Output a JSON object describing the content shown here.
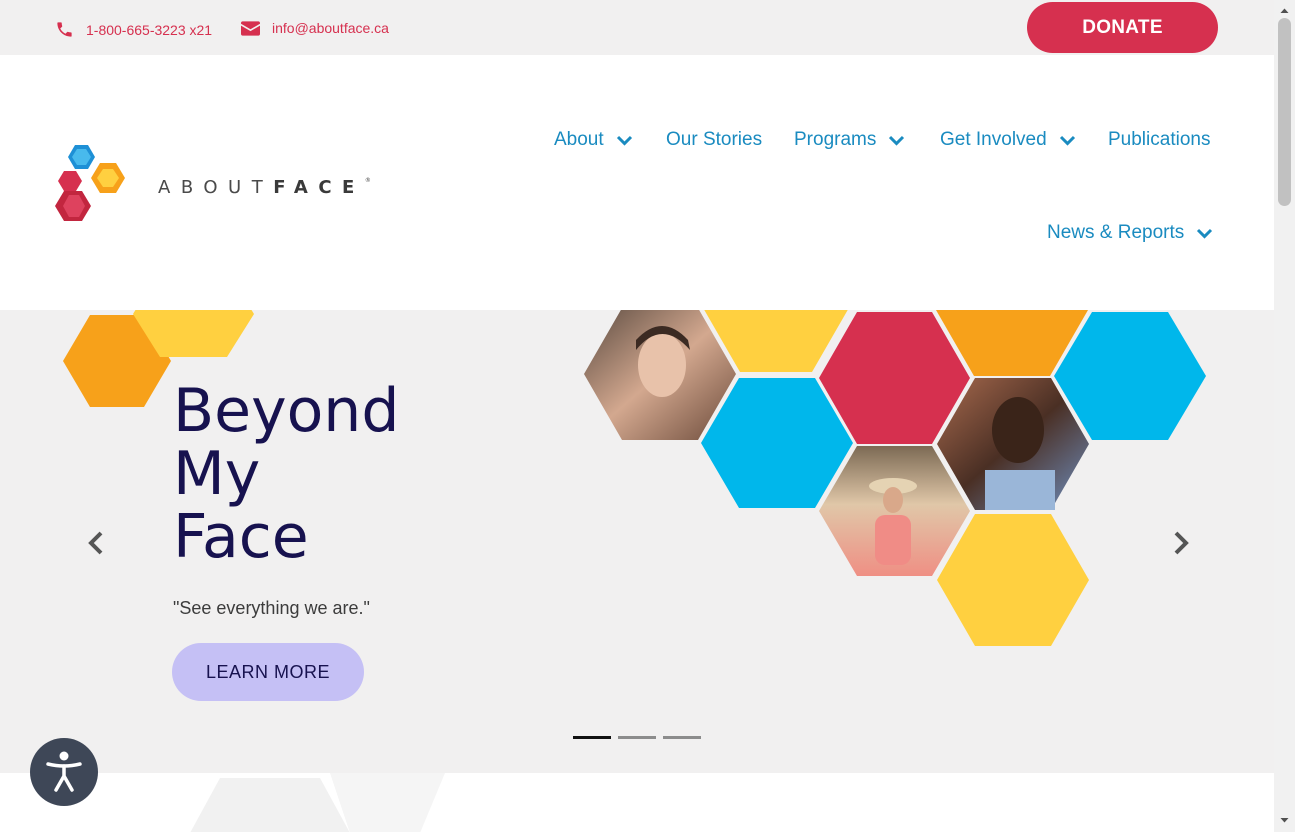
{
  "topbar": {
    "phone": "1-800-665-3223 x21",
    "email": "info@aboutface.ca",
    "donate_label": "DONATE"
  },
  "logo": {
    "text_light": "ABOUT",
    "text_bold": "FACE",
    "reg_mark": "®"
  },
  "nav": {
    "items": [
      {
        "label": "About",
        "has_dropdown": true
      },
      {
        "label": "Our Stories",
        "has_dropdown": false
      },
      {
        "label": "Programs",
        "has_dropdown": true
      },
      {
        "label": "Get Involved",
        "has_dropdown": true
      },
      {
        "label": "Publications",
        "has_dropdown": false
      },
      {
        "label": "News & Reports",
        "has_dropdown": true
      }
    ]
  },
  "hero": {
    "title_lines": [
      "Beyond",
      "My",
      "Face"
    ],
    "quote": "\"See everything we are.\"",
    "button_label": "LEARN MORE",
    "slide_count": 3,
    "active_slide": 1
  },
  "colors": {
    "brand_red": "#d6304f",
    "nav_blue": "#1a8bc0",
    "hero_navy": "#17124f",
    "hex_orange": "#f7a11a",
    "hex_yellow": "#ffd040",
    "hex_blue": "#00b7eb",
    "hex_red": "#d6304f",
    "button_lavender": "#c5c0f5"
  },
  "icons": [
    "phone-icon",
    "envelope-icon",
    "chevron-down-icon",
    "carousel-prev-icon",
    "carousel-next-icon",
    "accessibility-icon"
  ]
}
